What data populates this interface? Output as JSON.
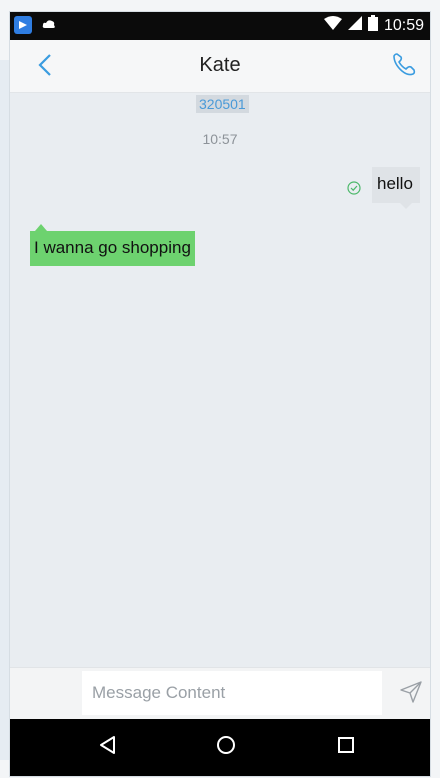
{
  "status_bar": {
    "time": "10:59",
    "icons": [
      "app-notification-icon",
      "cloud-icon",
      "wifi-icon",
      "signal-icon",
      "battery-icon"
    ]
  },
  "header": {
    "title": "Kate",
    "back_icon": "back-chevron-icon",
    "call_icon": "phone-icon"
  },
  "messages": {
    "sender_id": "320501",
    "timestamp": "10:57",
    "items": [
      {
        "direction": "outgoing",
        "text": "hello",
        "status": "delivered"
      },
      {
        "direction": "incoming",
        "text": "I wanna go shopping"
      }
    ]
  },
  "composer": {
    "placeholder": "Message Content",
    "value": "",
    "send_icon": "send-icon"
  },
  "nav": {
    "icons": [
      "nav-back-icon",
      "nav-home-icon",
      "nav-recents-icon"
    ]
  },
  "colors": {
    "accent": "#3a9ce0",
    "incoming_bubble": "#6dd26f",
    "outgoing_bubble": "#dfe3e7",
    "chat_background": "#e9edf1",
    "delivered_check": "#4cb86a"
  }
}
